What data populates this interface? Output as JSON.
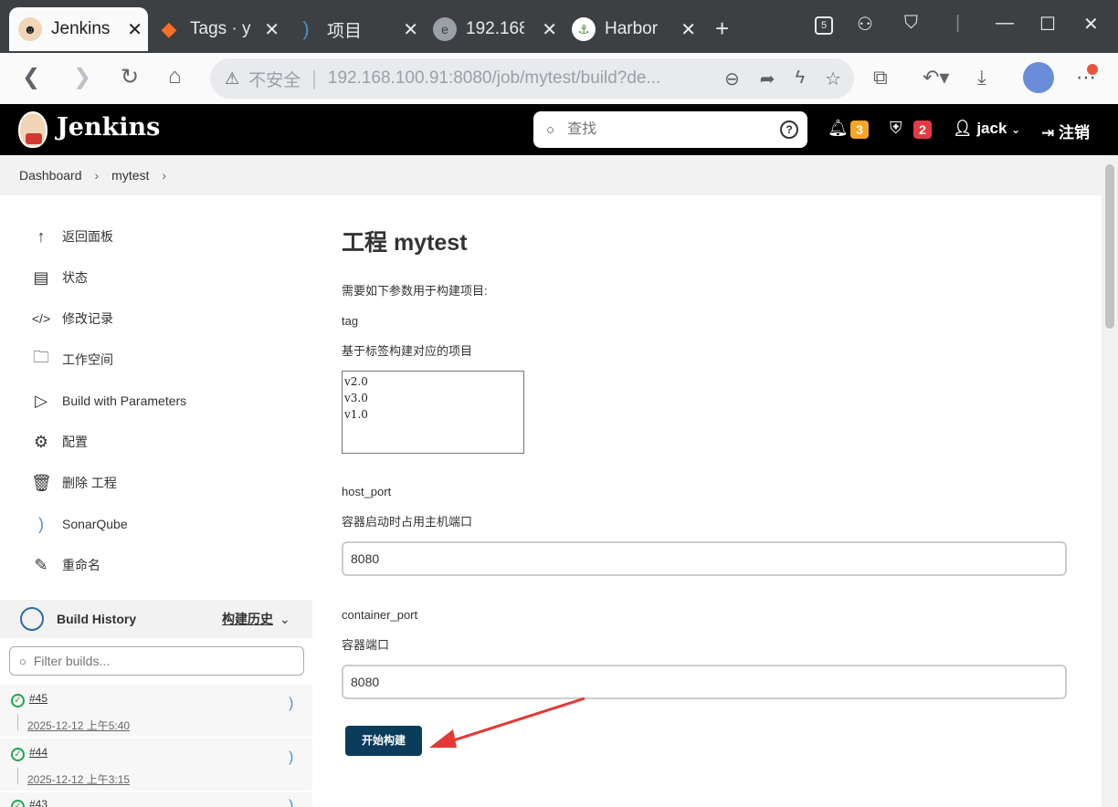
{
  "browser": {
    "tabs": [
      {
        "label": "Jenkins",
        "icon": "jenkins-icon",
        "active": true
      },
      {
        "label": "Tags · y",
        "icon": "gitlab-icon",
        "active": false
      },
      {
        "label": "项目",
        "icon": "sonarqube-icon",
        "active": false
      },
      {
        "label": "192.168",
        "icon": "globe-icon",
        "active": false
      },
      {
        "label": "Harbor",
        "icon": "harbor-icon",
        "active": false
      }
    ],
    "tab_count_badge": "5",
    "insecure_label": "不安全",
    "url": "192.168.100.91:8080/job/mytest/build?de..."
  },
  "header": {
    "title": "Jenkins",
    "search_placeholder": "查找",
    "notifications_count": "3",
    "security_count": "2",
    "user": "jack",
    "logout_label": "注销",
    "colors": {
      "notif_badge": "#f5a623",
      "security_badge": "#e63946"
    }
  },
  "breadcrumb": {
    "items": [
      "Dashboard",
      "mytest"
    ]
  },
  "sidebar": {
    "items": [
      {
        "label": "返回面板",
        "icon": "arrow-up-icon"
      },
      {
        "label": "状态",
        "icon": "document-icon"
      },
      {
        "label": "修改记录",
        "icon": "code-icon"
      },
      {
        "label": "工作空间",
        "icon": "folder-icon"
      },
      {
        "label": "Build with Parameters",
        "icon": "play-icon"
      },
      {
        "label": "配置",
        "icon": "gear-icon"
      },
      {
        "label": "删除 工程",
        "icon": "trash-icon"
      },
      {
        "label": "SonarQube",
        "icon": "sonarqube-icon"
      },
      {
        "label": "重命名",
        "icon": "pencil-icon"
      }
    ]
  },
  "build_history": {
    "title": "Build History",
    "trend_label": "构建历史",
    "filter_placeholder": "Filter builds...",
    "builds": [
      {
        "number": "#45",
        "date": "2025-12-12 上午5:40",
        "status": "success"
      },
      {
        "number": "#44",
        "date": "2025-12-12 上午3:15",
        "status": "success"
      },
      {
        "number": "#43",
        "date": "",
        "status": "success"
      }
    ]
  },
  "main": {
    "title": "工程 mytest",
    "intro": "需要如下参数用于构建项目:",
    "params": [
      {
        "name": "tag",
        "description": "基于标签构建对应的项目",
        "type": "select",
        "options": [
          "v2.0",
          "v3.0",
          "v1.0"
        ]
      },
      {
        "name": "host_port",
        "description": "容器启动时占用主机端口",
        "type": "text",
        "value": "8080"
      },
      {
        "name": "container_port",
        "description": "容器端口",
        "type": "text",
        "value": "8080"
      }
    ],
    "build_button": "开始构建"
  }
}
